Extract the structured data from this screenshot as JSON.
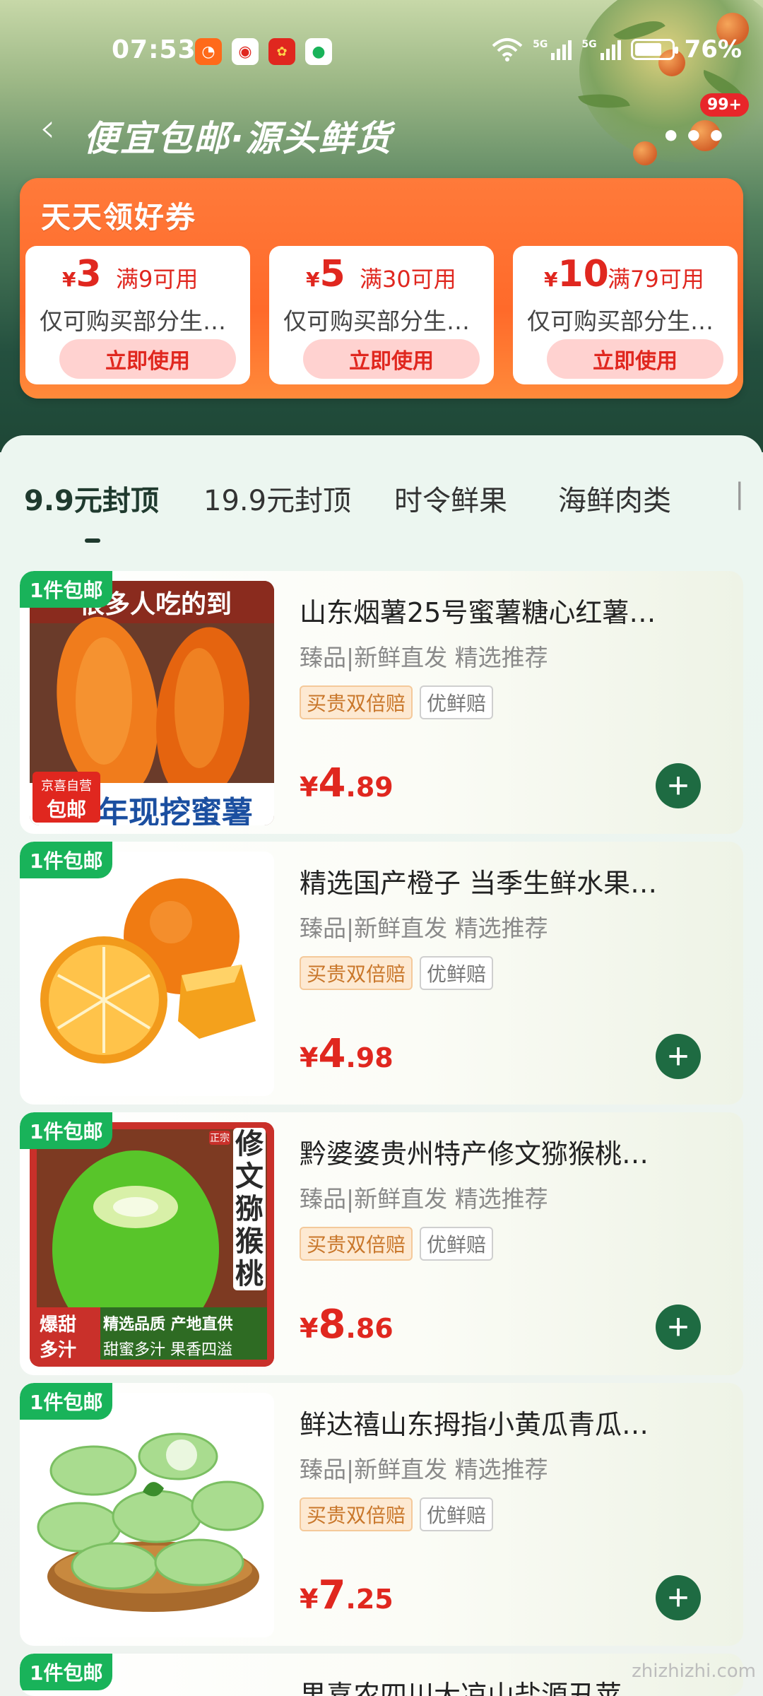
{
  "status_bar": {
    "time": "07:53",
    "network1": "5G",
    "network2": "5G",
    "battery": "76%"
  },
  "nav": {
    "title": "便宜包邮·源头鲜货",
    "badge": "99+"
  },
  "coupons": {
    "title": "天天领好券",
    "items": [
      {
        "currency": "¥",
        "amount": "3",
        "condition": "满9可用",
        "desc": "仅可购买部分生…",
        "button": "立即使用"
      },
      {
        "currency": "¥",
        "amount": "5",
        "condition": "满30可用",
        "desc": "仅可购买部分生…",
        "button": "立即使用"
      },
      {
        "currency": "¥",
        "amount": "10",
        "condition": "满79可用",
        "desc": "仅可购买部分生…",
        "button": "立即使用"
      }
    ]
  },
  "tabs": [
    {
      "label": "9.9元封顶"
    },
    {
      "label": "19.9元封顶"
    },
    {
      "label": "时令鲜果"
    },
    {
      "label": "海鲜肉类"
    }
  ],
  "products": [
    {
      "ship_tag": "1件包邮",
      "name": "山东烟薯25号蜜薯糖心红薯…",
      "sub": "臻品|新鲜直发 精选推荐",
      "chip1": "买贵双倍赔",
      "chip2": "优鲜赔",
      "price_currency": "¥",
      "price_int": "4",
      "price_dec": ".89",
      "img_top": "很多人吃的到",
      "img_bottom": "年现挖蜜薯",
      "img_badge1": "京喜自营",
      "img_badge2": "包邮"
    },
    {
      "ship_tag": "1件包邮",
      "name": "精选国产橙子 当季生鲜水果…",
      "sub": "臻品|新鲜直发 精选推荐",
      "chip1": "买贵双倍赔",
      "chip2": "优鲜赔",
      "price_currency": "¥",
      "price_int": "4",
      "price_dec": ".98"
    },
    {
      "ship_tag": "1件包邮",
      "name": "黔婆婆贵州特产修文猕猴桃…",
      "sub": "臻品|新鲜直发 精选推荐",
      "chip1": "买贵双倍赔",
      "chip2": "优鲜赔",
      "price_currency": "¥",
      "price_int": "8",
      "price_dec": ".86",
      "img_side": "修文猕猴桃",
      "img_zheng": "正宗",
      "img_l1": "爆甜",
      "img_l2": "多汁",
      "img_r1": "精选品质 产地直供",
      "img_r2": "甜蜜多汁 果香四溢"
    },
    {
      "ship_tag": "1件包邮",
      "name": "鲜达禧山东拇指小黄瓜青瓜…",
      "sub": "臻品|新鲜直发 精选推荐",
      "chip1": "买贵双倍赔",
      "chip2": "优鲜赔",
      "price_currency": "¥",
      "price_int": "7",
      "price_dec": ".25"
    },
    {
      "ship_tag": "1件包邮",
      "name": "果喜农四川大凉山盐源丑苹…"
    }
  ],
  "watermark": "zhizhizhi.com",
  "colors": {
    "accent_red": "#e0271f",
    "brand_green": "#1e6b42",
    "ship_tag_green": "#19b35a",
    "coupon_orange": "#ff6a2a"
  }
}
